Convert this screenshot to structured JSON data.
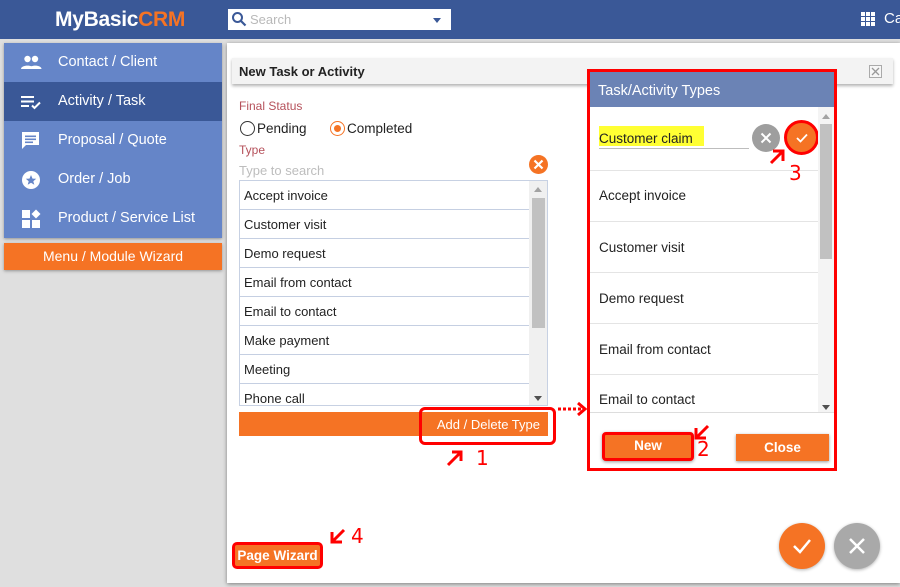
{
  "app": {
    "logo_part1": "MyBasic",
    "logo_part2": "CRM",
    "search_placeholder": "Search",
    "user_label_cut": "Ca"
  },
  "sidebar": {
    "items": [
      {
        "label": "Contact / Client",
        "icon": "people-icon",
        "active": false
      },
      {
        "label": "Activity / Task",
        "icon": "checklist-icon",
        "active": true
      },
      {
        "label": "Proposal / Quote",
        "icon": "comment-icon",
        "active": false
      },
      {
        "label": "Order / Job",
        "icon": "star-circle-icon",
        "active": false
      },
      {
        "label": "Product / Service List",
        "icon": "widgets-icon",
        "active": false
      }
    ],
    "wizard_button": "Menu / Module Wizard"
  },
  "dialog": {
    "title": "New Task or Activity",
    "final_status_label": "Final Status",
    "status_options": [
      {
        "label": "Pending",
        "selected": false
      },
      {
        "label": "Completed",
        "selected": true
      }
    ],
    "type_label": "Type",
    "type_search_placeholder": "Type to search",
    "type_search_value": "",
    "types": [
      "Accept invoice",
      "Customer visit",
      "Demo request",
      "Email from contact",
      "Email to contact",
      "Make payment",
      "Meeting",
      "Phone call"
    ],
    "add_delete_button": "Add / Delete Type",
    "page_wizard_button": "Page Wizard"
  },
  "types_modal": {
    "title": "Task/Activity Types",
    "new_type_value": "Customer claim",
    "items": [
      "Accept invoice",
      "Customer visit",
      "Demo request",
      "Email from contact",
      "Email to contact"
    ],
    "new_button": "New",
    "close_button": "Close"
  },
  "annotations": {
    "step1": "1",
    "step2": "2",
    "step3": "3",
    "step4": "4"
  },
  "colors": {
    "header_blue": "#3a5897",
    "sidebar_blue": "#6585c8",
    "accent_orange": "#f57324",
    "annotation_red": "#ff0000",
    "highlight_yellow": "#ffff33"
  }
}
